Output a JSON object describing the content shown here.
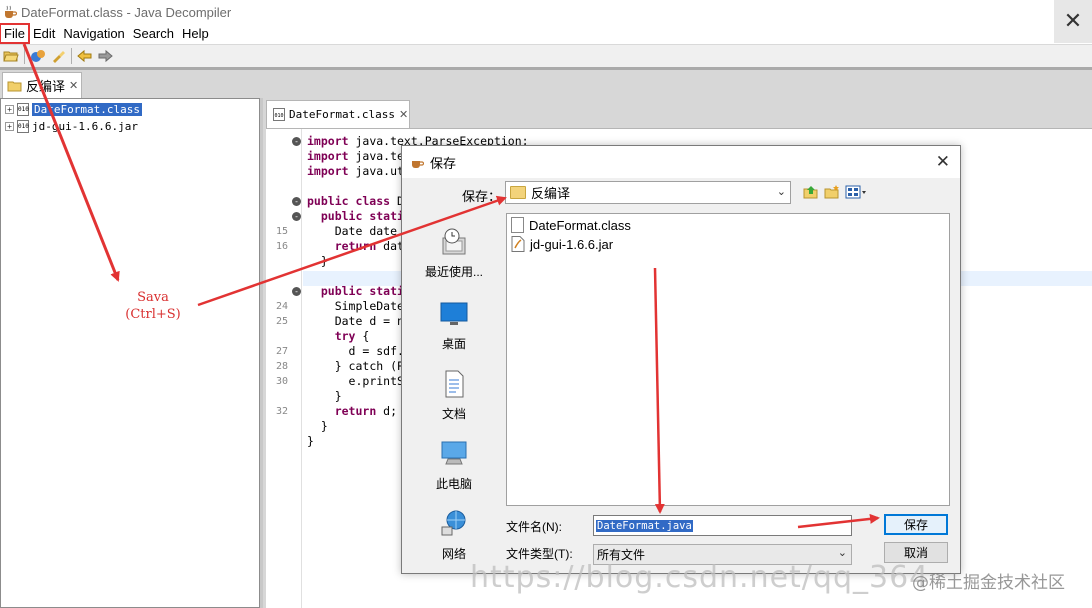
{
  "window": {
    "title": "DateFormat.class - Java Decompiler",
    "close_glyph": "✕"
  },
  "menu": [
    "File",
    "Edit",
    "Navigation",
    "Search",
    "Help"
  ],
  "left_tab": {
    "label": "反编译",
    "close_glyph": "✕"
  },
  "tree": [
    {
      "label": "DateFormat.class",
      "selected": true,
      "icon_text": "010"
    },
    {
      "label": "jd-gui-1.6.6.jar",
      "selected": false,
      "icon_text": "010"
    }
  ],
  "editor_tab": {
    "label": "DateFormat.class",
    "close_glyph": "✕"
  },
  "code_lines": [
    {
      "ln": "",
      "fold": "-",
      "indent": "",
      "kw": "import",
      "rest": " java.text.ParseException;"
    },
    {
      "ln": "",
      "fold": "",
      "indent": "",
      "kw": "import",
      "rest": " java.te"
    },
    {
      "ln": "",
      "fold": "",
      "indent": "",
      "kw": "import",
      "rest": " java.ut"
    },
    {
      "ln": "",
      "fold": "",
      "indent": "",
      "kw": "",
      "rest": ""
    },
    {
      "ln": "",
      "fold": "-",
      "indent": "",
      "kw": "public class",
      "rest": " D"
    },
    {
      "ln": "",
      "fold": "-",
      "indent": "  ",
      "kw": "public stati",
      "rest": ""
    },
    {
      "ln": "15",
      "fold": "",
      "indent": "    ",
      "kw": "",
      "rest": "Date date"
    },
    {
      "ln": "16",
      "fold": "",
      "indent": "    ",
      "kw": "return",
      "rest": " dat"
    },
    {
      "ln": "",
      "fold": "",
      "indent": "  ",
      "kw": "",
      "rest": "}"
    },
    {
      "ln": "",
      "fold": "",
      "indent": "",
      "kw": "",
      "rest": ""
    },
    {
      "ln": "",
      "fold": "-",
      "indent": "  ",
      "kw": "public stati",
      "rest": ""
    },
    {
      "ln": "24",
      "fold": "",
      "indent": "    ",
      "kw": "",
      "rest": "SimpleDate"
    },
    {
      "ln": "25",
      "fold": "",
      "indent": "    ",
      "kw": "",
      "rest": "Date d = n"
    },
    {
      "ln": "",
      "fold": "",
      "indent": "    ",
      "kw": "try",
      "rest": " {"
    },
    {
      "ln": "27",
      "fold": "",
      "indent": "      ",
      "kw": "",
      "rest": "d = sdf."
    },
    {
      "ln": "28",
      "fold": "",
      "indent": "    ",
      "kw": "",
      "rest": "} catch (P"
    },
    {
      "ln": "30",
      "fold": "",
      "indent": "      ",
      "kw": "",
      "rest": "e.printS"
    },
    {
      "ln": "",
      "fold": "",
      "indent": "    ",
      "kw": "",
      "rest": "}"
    },
    {
      "ln": "32",
      "fold": "",
      "indent": "    ",
      "kw": "return",
      "rest": " d;"
    },
    {
      "ln": "",
      "fold": "",
      "indent": "  ",
      "kw": "",
      "rest": "}"
    },
    {
      "ln": "",
      "fold": "",
      "indent": "",
      "kw": "",
      "rest": "}"
    }
  ],
  "annotation": {
    "line1": "Sava",
    "line2": "(Ctrl+S)",
    "color": "#d93030"
  },
  "dialog": {
    "title": "保存",
    "close_glyph": "✕",
    "lookin_label": "保存：",
    "lookin_value": "反编译",
    "places": [
      "最近使用...",
      "桌面",
      "文档",
      "此电脑",
      "网络"
    ],
    "files": [
      "DateFormat.class",
      "jd-gui-1.6.6.jar"
    ],
    "filename_label": "文件名(N):",
    "filename_value": "DateFormat.java",
    "filetype_label": "文件类型(T):",
    "filetype_value": "所有文件",
    "save_button": "保存",
    "cancel_button": "取消"
  },
  "watermark": {
    "text": "https://blog.csdn.net/qq_364",
    "badge": "@稀土掘金技术社区"
  },
  "colors": {
    "accent": "#0078d7",
    "selection": "#316ac5",
    "annotation": "#e23333"
  }
}
